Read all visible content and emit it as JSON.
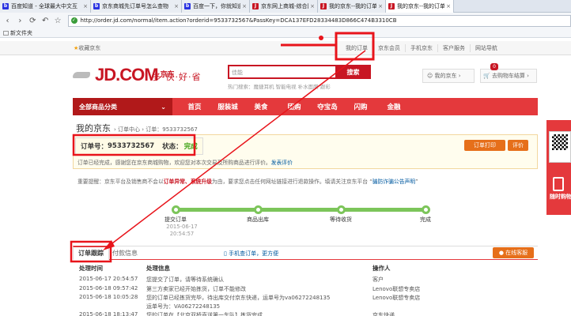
{
  "browser": {
    "tabs": [
      {
        "label": "百度知道 - 全球最大中文互",
        "favicon": "baidu"
      },
      {
        "label": "京东商城先订单号怎么查物",
        "favicon": "baidu"
      },
      {
        "label": "百度一下，你就知道",
        "favicon": "baidu"
      },
      {
        "label": "京东网上商城-综合网购首",
        "favicon": "jd"
      },
      {
        "label": "我的京东--我的订单",
        "favicon": "jd"
      },
      {
        "label": "我的京东--我的订单",
        "favicon": "jd",
        "active": true
      }
    ],
    "address": "http://order.jd.com/normal/item.action?orderid=9533732567&PassKey=DCA137EFD28334483D866C474B3310CB",
    "bookmark": "新文件夹"
  },
  "jd_topbar": {
    "favorite": "收藏京东",
    "nav": [
      "我的订单",
      "京东会员",
      "手机京东",
      "客户服务",
      "网站导航"
    ]
  },
  "header": {
    "logo_text": "JD.COM",
    "logo_cn": "京东",
    "slogan": "多·快·好·省",
    "search_placeholder": "佳能",
    "search_button": "搜索",
    "hot_words": "热门搜索：魔捷耳机  智能电视  补水面膜  跟彩",
    "myjd": "我的京东",
    "cart_label": "去购物车结算",
    "cart_count": "0"
  },
  "nav": {
    "all_categories": "全部商品分类",
    "items": [
      "首页",
      "服装城",
      "美食",
      "团购",
      "夺宝岛",
      "闪购",
      "金融"
    ]
  },
  "breadcrumb": {
    "title": "我的京东",
    "path": "› 订单中心 › 订单：9533732567"
  },
  "order": {
    "number_label": "订单号：",
    "number": "9533732567",
    "status_label": "状态：",
    "status": "完成",
    "print_button": "订单打印",
    "rate_button": "评价",
    "note": "订单已经完成，感谢您在京东商城购物，欢迎您对本次交易及所购商品进行评价。",
    "note_link": "发表评价",
    "warning_prefix": "重要提醒：京东平台及销售商不会以",
    "warning_red": "订单异常、系统升级",
    "warning_mid": "为由，要求您点击任何网址链接进行退款操作。填请关注京东平台 “",
    "warning_link": "骗防诈骗公告声明",
    "warning_suffix": "”"
  },
  "progress": {
    "steps": [
      {
        "label": "提交订单",
        "time1": "2015-06-17",
        "time2": "20:54:57"
      },
      {
        "label": "商品出库",
        "time1": "",
        "time2": ""
      },
      {
        "label": "等待收货",
        "time1": "",
        "time2": ""
      },
      {
        "label": "完成",
        "time1": "",
        "time2": ""
      }
    ]
  },
  "tracking": {
    "tab_track": "订单跟踪",
    "tab_pay": "付款信息",
    "mobile_link": "手机查订单，更方便",
    "cs_button": "在线客服",
    "headers": [
      "处理时间",
      "处理信息",
      "操作人"
    ],
    "rows": [
      {
        "time": "2015-06-17 20:54:57",
        "info": "您提交了订单，请等待系统确认",
        "op": "客户"
      },
      {
        "time": "2015-06-18 09:57:42",
        "info": "第三方卖家已经开始拣货，订单不能修改",
        "op": "Lenovo联想专卖店"
      },
      {
        "time": "2015-06-18 10:05:28",
        "info": "您的订单已经拣货完毕，待出库交付京东快递，运单号为va06272248135",
        "op": "Lenovo联想专卖店"
      },
      {
        "time": "",
        "info": "运单号为：VA06272248135",
        "op": ""
      },
      {
        "time": "2015-06-18 18:13:47",
        "info": "您的订单在【北京双桥直送第一车队】拣货完成",
        "op": "京东快递"
      }
    ]
  },
  "side_ad": {
    "label": "随时购物"
  },
  "colors": {
    "jd_red": "#e4393c",
    "annotation_red": "#e8141b",
    "status_green": "#2d9a00",
    "progress_green": "#7cc55a"
  }
}
